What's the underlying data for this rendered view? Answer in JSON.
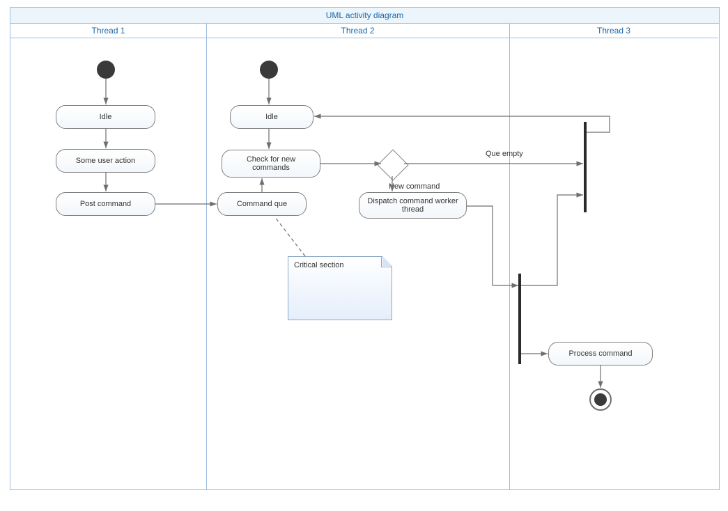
{
  "title": "UML activity diagram",
  "lanes": {
    "l1": "Thread 1",
    "l2": "Thread 2",
    "l3": "Thread 3"
  },
  "nodes": {
    "t1_idle": "Idle",
    "t1_user_action": "Some user action",
    "t1_post_cmd": "Post command",
    "t2_idle": "Idle",
    "t2_check": "Check for new commands",
    "t2_queue": "Command que",
    "t2_dispatch": "Dispatch command worker thread",
    "note_critical": "Critical section",
    "t3_process": "Process command"
  },
  "edge_labels": {
    "new_command": "New command",
    "queue_empty": "Que empty"
  }
}
